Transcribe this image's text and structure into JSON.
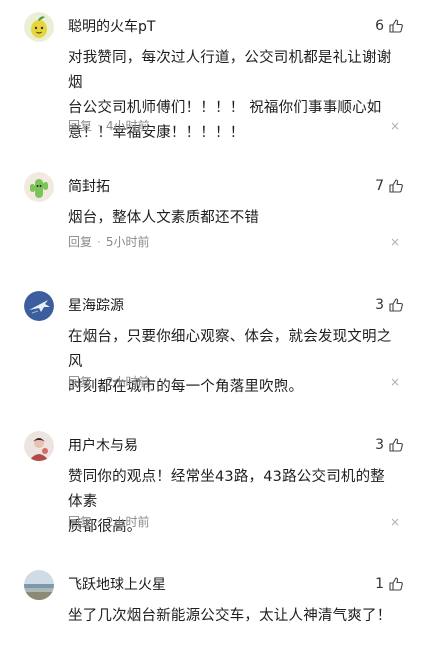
{
  "comments": [
    {
      "user": "聪明的火车pT",
      "likes": "6",
      "lines": [
        "对我赞同，每次过人行道，公交司机都是礼让谢谢烟",
        "台公交司机师傅们！！！！ 祝福你们事事顺心如",
        "意！！幸福安康！！！！！"
      ],
      "reply": "回复",
      "time": "4小时前",
      "close": "×",
      "avatar_icon": "lemon-avatar-icon"
    },
    {
      "user": "简封拓",
      "likes": "7",
      "lines": [
        "烟台，整体人文素质都还不错"
      ],
      "reply": "回复",
      "time": "5小时前",
      "close": "×",
      "avatar_icon": "cactus-avatar-icon"
    },
    {
      "user": "星海踪源",
      "likes": "3",
      "lines": [
        "在烟台，只要你细心观察、体会，就会发现文明之风",
        "时刻都在城市的每一个角落里吹煦。"
      ],
      "reply": "回复",
      "time": "2小时前",
      "close": "×",
      "avatar_icon": "jet-avatar-icon"
    },
    {
      "user": "用户木与易",
      "likes": "3",
      "lines": [
        "赞同你的观点！经常坐43路，43路公交司机的整体素",
        "质都很高。"
      ],
      "reply": "回复",
      "time": "2小时前",
      "close": "×",
      "avatar_icon": "portrait-avatar-icon"
    },
    {
      "user": "飞跃地球上火星",
      "likes": "1",
      "lines": [
        "坐了几次烟台新能源公交车，太让人神清气爽了！"
      ],
      "reply": "",
      "time": "",
      "close": "",
      "avatar_icon": "seascape-avatar-icon"
    }
  ],
  "separator": "·"
}
